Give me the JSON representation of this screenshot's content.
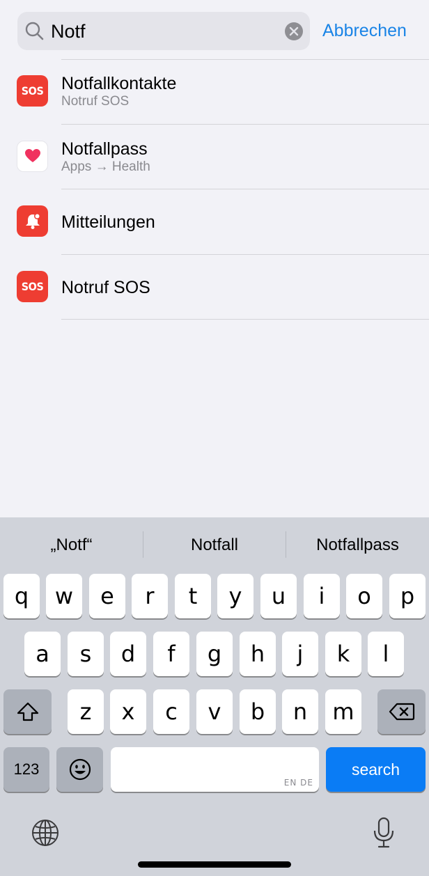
{
  "search": {
    "query": "Notf",
    "cancel_label": "Abbrechen"
  },
  "results": [
    {
      "title": "Notfallkontakte",
      "subtitle": "Notruf SOS",
      "icon": "sos-icon",
      "icon_text": "SOS"
    },
    {
      "title": "Notfallpass",
      "subtitle": "Apps → Health",
      "icon": "health-heart-icon"
    },
    {
      "title": "Mitteilungen",
      "subtitle": "",
      "icon": "notification-bell-icon"
    },
    {
      "title": "Notruf SOS",
      "subtitle": "",
      "icon": "sos-icon",
      "icon_text": "SOS"
    }
  ],
  "keyboard": {
    "suggestions": [
      "„Notf“",
      "Notfall",
      "Notfallpass"
    ],
    "row1": [
      "q",
      "w",
      "e",
      "r",
      "t",
      "y",
      "u",
      "i",
      "o",
      "p"
    ],
    "row2": [
      "a",
      "s",
      "d",
      "f",
      "g",
      "h",
      "j",
      "k",
      "l"
    ],
    "row3": [
      "z",
      "x",
      "c",
      "v",
      "b",
      "n",
      "m"
    ],
    "numbers_label": "123",
    "space_languages": "EN DE",
    "search_label": "search"
  },
  "colors": {
    "accent": "#1a84e6",
    "sos_red": "#ee3d32",
    "search_key": "#0a7cf5",
    "background": "#f2f2f7",
    "keyboard_bg": "#d0d3da"
  }
}
